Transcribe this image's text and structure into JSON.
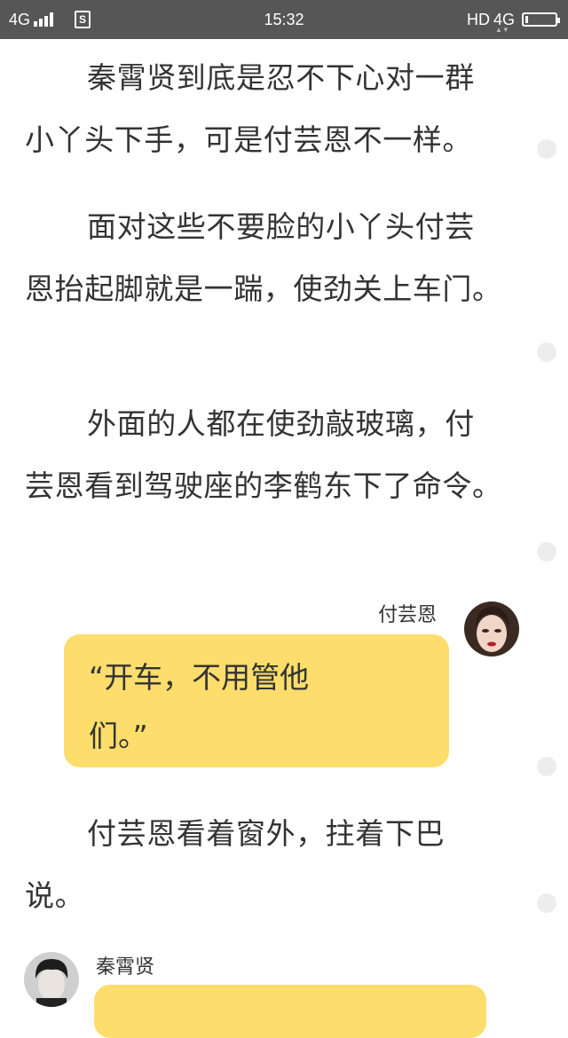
{
  "status_bar": {
    "network_left": "4G",
    "sim_icon": "S",
    "time": "15:32",
    "hd_label": "HD",
    "network_right": "4G",
    "battery_level": 0.08
  },
  "story": {
    "paragraphs": [
      "秦霄贤到底是忍不下心对一群小丫头下手，可是付芸恩不一样。",
      "面对这些不要脸的小丫头付芸恩抬起脚就是一踹，使劲关上车门。",
      "外面的人都在使劲敲玻璃，付芸恩看到驾驶座的李鹤东下了命令。",
      "付芸恩看着窗外，拄着下巴说。"
    ]
  },
  "dialogs": [
    {
      "speaker": "付芸恩",
      "text": "“开车，不用管他们。”",
      "side": "right",
      "bubble_color": "#fddd6b"
    },
    {
      "speaker": "秦霄贤",
      "text": "",
      "side": "left",
      "bubble_color": "#fddd6b"
    }
  ],
  "icons": {
    "comment_dot": "comment-dot-icon"
  }
}
